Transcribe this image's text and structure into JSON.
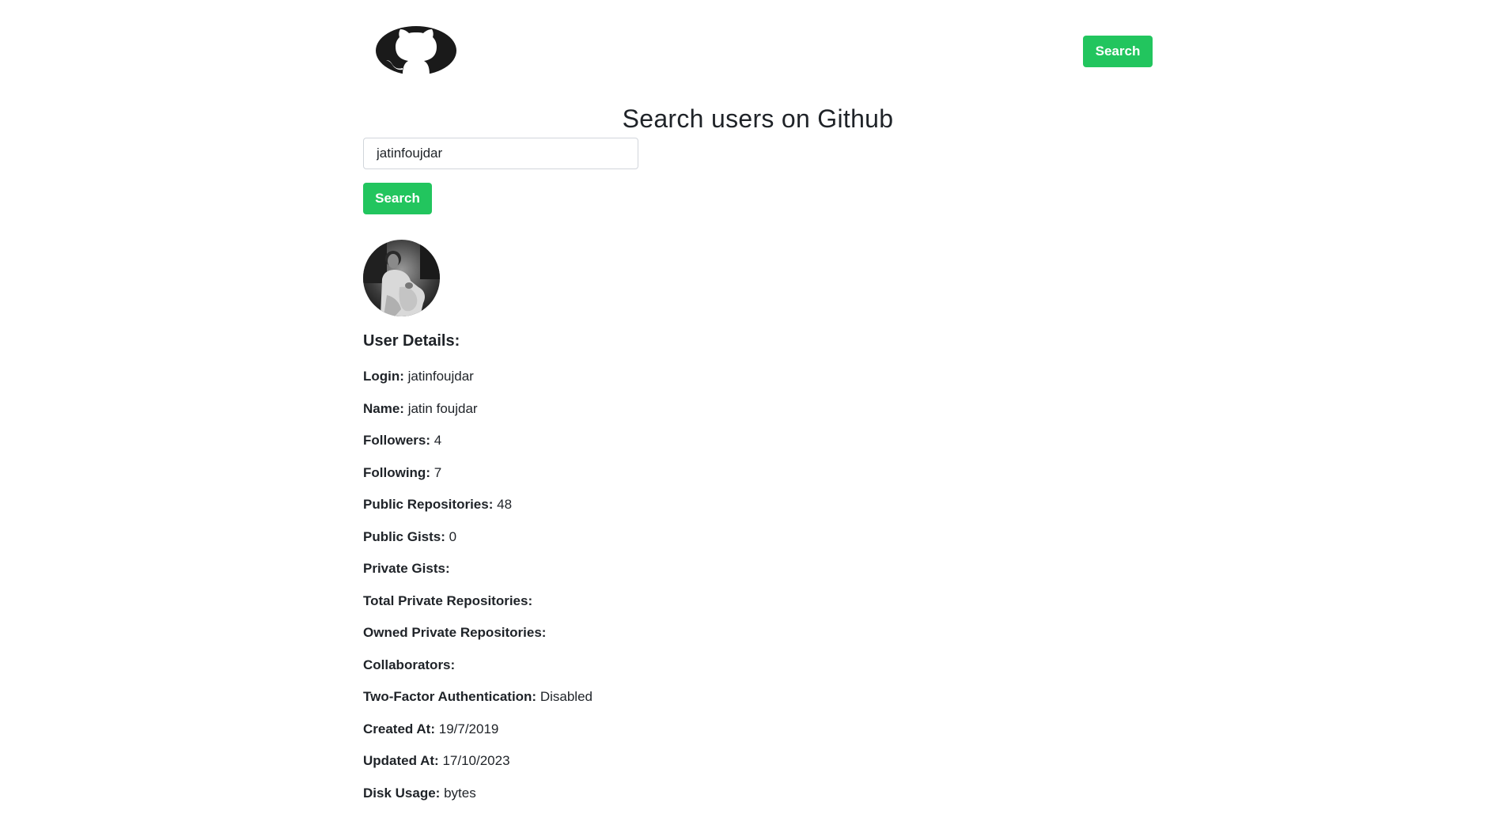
{
  "header": {
    "search_button": "Search"
  },
  "page_title": "Search users on Github",
  "search": {
    "value": "jatinfoujdar",
    "button": "Search"
  },
  "details": {
    "heading": "User Details:",
    "items": [
      {
        "label": "Login:",
        "value": "jatinfoujdar"
      },
      {
        "label": "Name:",
        "value": "jatin foujdar"
      },
      {
        "label": "Followers:",
        "value": "4"
      },
      {
        "label": "Following:",
        "value": "7"
      },
      {
        "label": "Public Repositories:",
        "value": "48"
      },
      {
        "label": "Public Gists:",
        "value": "0"
      },
      {
        "label": "Private Gists:",
        "value": ""
      },
      {
        "label": "Total Private Repositories:",
        "value": ""
      },
      {
        "label": "Owned Private Repositories:",
        "value": ""
      },
      {
        "label": "Collaborators:",
        "value": ""
      },
      {
        "label": "Two-Factor Authentication:",
        "value": "Disabled"
      },
      {
        "label": "Created At:",
        "value": "19/7/2019"
      },
      {
        "label": "Updated At:",
        "value": "17/10/2023"
      },
      {
        "label": "Disk Usage:",
        "value": "bytes"
      }
    ]
  },
  "colors": {
    "accent": "#22c55e",
    "text": "#1f2328"
  },
  "icons": {
    "logo": "github-octocat-icon",
    "avatar": "user-avatar-photo"
  }
}
